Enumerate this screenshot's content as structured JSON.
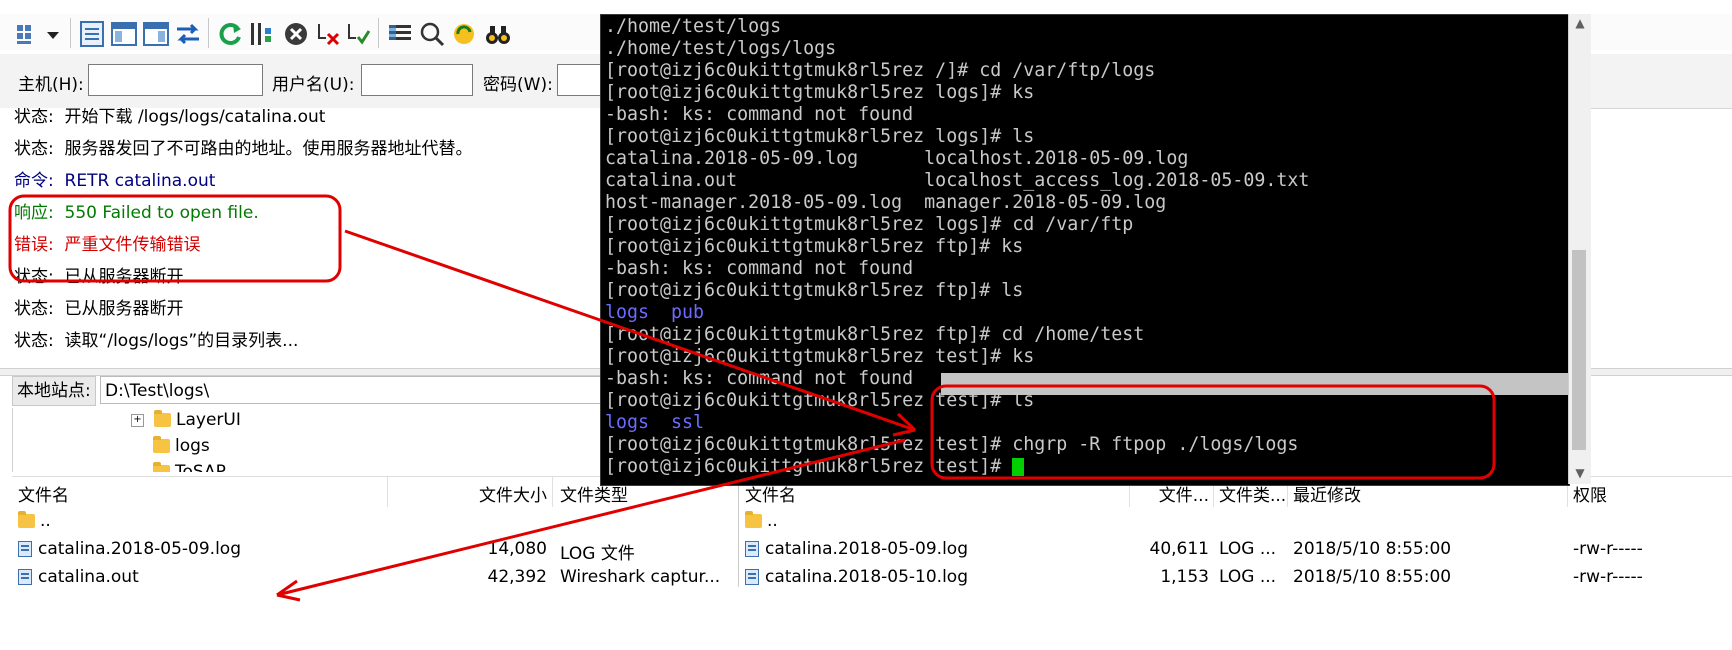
{
  "quickconnect": {
    "host_label": "主机(H):",
    "user_label": "用户名(U):",
    "pass_label": "密码(W):",
    "host_value": "",
    "user_value": "",
    "pass_value": ""
  },
  "log": {
    "lines": [
      {
        "prefix": "状态:",
        "text": "开始下载 /logs/logs/catalina.out",
        "kind": "status"
      },
      {
        "prefix": "状态:",
        "text": "服务器发回了不可路由的地址。使用服务器地址代替。",
        "kind": "status"
      },
      {
        "prefix": "命令:",
        "text": "RETR catalina.out",
        "kind": "cmd"
      },
      {
        "prefix": "响应:",
        "text": "550 Failed to open file.",
        "kind": "ok"
      },
      {
        "prefix": "错误:",
        "text": "严重文件传输错误",
        "kind": "err"
      },
      {
        "prefix": "状态:",
        "text": "已从服务器断开",
        "kind": "status"
      },
      {
        "prefix": "状态:",
        "text": "已从服务器断开",
        "kind": "status"
      },
      {
        "prefix": "状态:",
        "text": "读取“/logs/logs”的目录列表...",
        "kind": "status"
      }
    ]
  },
  "local": {
    "label": "本地站点:",
    "path": "D:\\Test\\logs\\",
    "tree": [
      "LayerUI",
      "logs",
      "ToSAP"
    ],
    "headers": {
      "name": "文件名",
      "size": "文件大小",
      "type": "文件类型"
    },
    "files": [
      {
        "name": "..",
        "size": "",
        "type": ""
      },
      {
        "name": "catalina.2018-05-09.log",
        "size": "14,080",
        "type": "LOG 文件"
      },
      {
        "name": "catalina.out",
        "size": "42,392",
        "type": "Wireshark captur..."
      }
    ]
  },
  "remote": {
    "headers": {
      "name": "文件名",
      "size": "文件...",
      "type": "文件类...",
      "modified": "最近修改",
      "perm": "权限"
    },
    "files": [
      {
        "name": "..",
        "size": "",
        "type": "",
        "modified": "",
        "perm": ""
      },
      {
        "name": "catalina.2018-05-09.log",
        "size": "40,611",
        "type": "LOG ...",
        "modified": "2018/5/10 8:55:00",
        "perm": "-rw-r-----"
      },
      {
        "name": "catalina.2018-05-10.log",
        "size": "1,153",
        "type": "LOG ...",
        "modified": "2018/5/10 8:55:00",
        "perm": "-rw-r-----"
      }
    ]
  },
  "terminal": {
    "lines": [
      "./home/test/logs",
      "./home/test/logs/logs",
      "[root@izj6c0ukittgtmuk8rl5rez /]# cd /var/ftp/logs",
      "[root@izj6c0ukittgtmuk8rl5rez logs]# ks",
      "-bash: ks: command not found",
      "[root@izj6c0ukittgtmuk8rl5rez logs]# ls",
      "catalina.2018-05-09.log      localhost.2018-05-09.log",
      "catalina.out                 localhost_access_log.2018-05-09.txt",
      "host-manager.2018-05-09.log  manager.2018-05-09.log",
      "[root@izj6c0ukittgtmuk8rl5rez logs]# cd /var/ftp",
      "[root@izj6c0ukittgtmuk8rl5rez ftp]# ks",
      "-bash: ks: command not found",
      "[root@izj6c0ukittgtmuk8rl5rez ftp]# ls",
      "logs  pub",
      "[root@izj6c0ukittgtmuk8rl5rez ftp]# cd /home/test",
      "[root@izj6c0ukittgtmuk8rl5rez test]# ks",
      "-bash: ks: command not found",
      "[root@izj6c0ukittgtmuk8rl5rez test]# ls",
      "logs  ssl",
      "[root@izj6c0ukittgtmuk8rl5rez test]# chgrp -R ftpop ./logs/logs",
      "[root@izj6c0ukittgtmuk8rl5rez test]# "
    ],
    "blue_line_indexes": [
      13,
      18
    ]
  },
  "colors": {
    "annotation_red": "#e00000",
    "cursor_green": "#00d000"
  }
}
